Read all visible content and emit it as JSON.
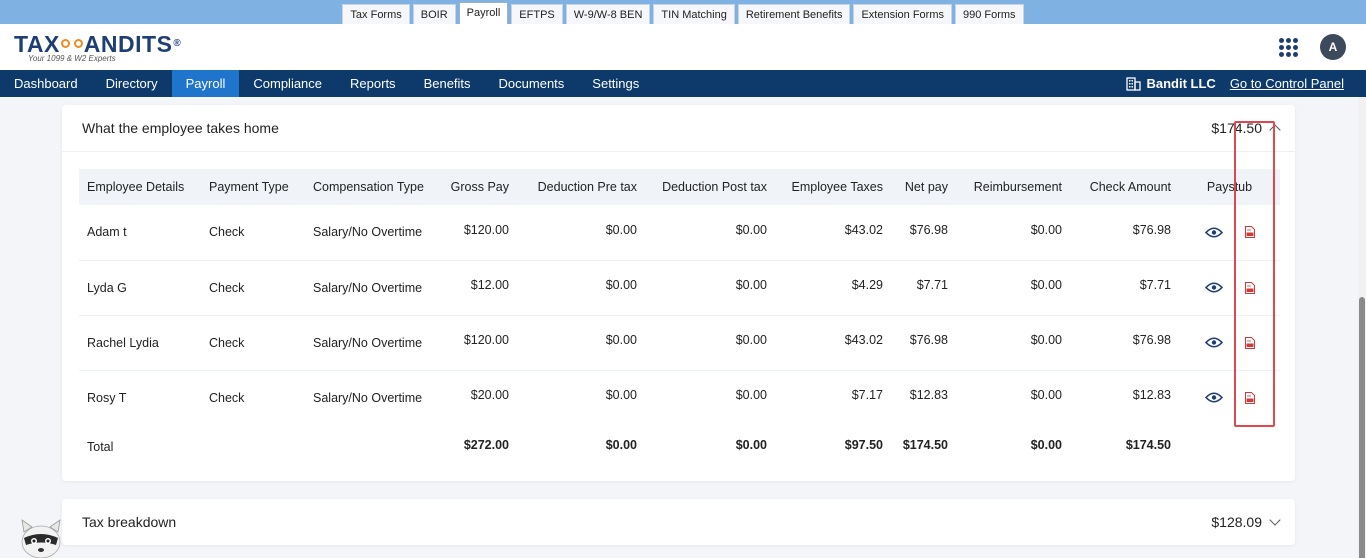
{
  "product_tabs": [
    "Tax Forms",
    "BOIR",
    "Payroll",
    "EFTPS",
    "W-9/W-8 BEN",
    "TIN Matching",
    "Retirement Benefits",
    "Extension Forms",
    "990 Forms"
  ],
  "active_product_tab": "Payroll",
  "logo": {
    "text_left": "TAX",
    "text_right": "ANDITS",
    "registered": "®",
    "tagline": "Your 1099 & W2 Experts"
  },
  "user": {
    "avatar_initial": "A"
  },
  "nav": {
    "items": [
      "Dashboard",
      "Directory",
      "Payroll",
      "Compliance",
      "Reports",
      "Benefits",
      "Documents",
      "Settings"
    ],
    "active": "Payroll",
    "company": "Bandit LLC",
    "control_panel_link": "Go to Control Panel"
  },
  "takes_home": {
    "title": "What the employee takes home",
    "amount": "$174.50",
    "columns": [
      "Employee Details",
      "Payment Type",
      "Compensation Type",
      "Gross Pay",
      "Deduction Pre tax",
      "Deduction Post tax",
      "Employee Taxes",
      "Net pay",
      "Reimbursement",
      "Check Amount",
      "Paystub"
    ],
    "rows": [
      {
        "name": "Adam t",
        "payment_type": "Check",
        "compensation_type": "Salary/No Overtime",
        "gross_pay": "$120.00",
        "deduction_pre_tax": "$0.00",
        "deduction_post_tax": "$0.00",
        "employee_taxes": "$43.02",
        "net_pay": "$76.98",
        "reimbursement": "$0.00",
        "check_amount": "$76.98"
      },
      {
        "name": "Lyda G",
        "payment_type": "Check",
        "compensation_type": "Salary/No Overtime",
        "gross_pay": "$12.00",
        "deduction_pre_tax": "$0.00",
        "deduction_post_tax": "$0.00",
        "employee_taxes": "$4.29",
        "net_pay": "$7.71",
        "reimbursement": "$0.00",
        "check_amount": "$7.71"
      },
      {
        "name": "Rachel Lydia",
        "payment_type": "Check",
        "compensation_type": "Salary/No Overtime",
        "gross_pay": "$120.00",
        "deduction_pre_tax": "$0.00",
        "deduction_post_tax": "$0.00",
        "employee_taxes": "$43.02",
        "net_pay": "$76.98",
        "reimbursement": "$0.00",
        "check_amount": "$76.98"
      },
      {
        "name": "Rosy T",
        "payment_type": "Check",
        "compensation_type": "Salary/No Overtime",
        "gross_pay": "$20.00",
        "deduction_pre_tax": "$0.00",
        "deduction_post_tax": "$0.00",
        "employee_taxes": "$7.17",
        "net_pay": "$12.83",
        "reimbursement": "$0.00",
        "check_amount": "$12.83"
      }
    ],
    "total": {
      "label": "Total",
      "gross_pay": "$272.00",
      "deduction_pre_tax": "$0.00",
      "deduction_post_tax": "$0.00",
      "employee_taxes": "$97.50",
      "net_pay": "$174.50",
      "reimbursement": "$0.00",
      "check_amount": "$174.50"
    }
  },
  "tax_breakdown": {
    "title": "Tax breakdown",
    "amount": "$128.09"
  },
  "colors": {
    "nav_bg": "#0d3a6a",
    "nav_active": "#1f75cb",
    "brand": "#1f3e74",
    "accent": "#f28a22",
    "highlight": "#e0484f"
  },
  "icons": {
    "apps": "apps-grid-icon",
    "company": "building-icon",
    "view": "eye-icon",
    "download": "pdf-icon"
  }
}
